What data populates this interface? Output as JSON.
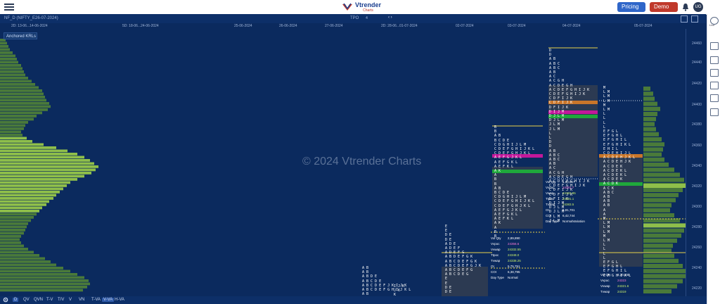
{
  "topbar": {
    "logo_name": "Vtrender",
    "logo_sub": "Charts",
    "pricing_label": "Pricing ₹",
    "demo_label": "Demo",
    "avatar_initials": "UG",
    "logo_mark_color": "#1a3f8f",
    "accent_red": "#c0392b"
  },
  "chartbar": {
    "symbol": "NF_D (NIFTY_E26-07-2024)",
    "timeframe": "TPO",
    "tpo_size": "4",
    "nav": "‹  ›"
  },
  "dates": [
    "2D: 13-06...14-06-2024",
    "5D: 18-06...24-06-2024",
    "25-06-2024",
    "26-06-2024",
    "27-06-2024",
    "2D: 28-06...01-07-2024",
    "02-07-2024",
    "03-07-2024",
    "04-07-2024",
    "05-07-2024"
  ],
  "anchored_label": "Anchored KRLs",
  "watermark": "© 2024 Vtrender Charts",
  "yaxis": [
    "24460",
    "24440",
    "24420",
    "24400",
    "24380",
    "24360",
    "24340",
    "24320",
    "24300",
    "24280",
    "24260",
    "24240",
    "24220"
  ],
  "sidebar": {
    "top_label": "Live"
  },
  "bottombar": {
    "items": [
      "D",
      "QV",
      "QVN",
      "T-V",
      "T/V",
      "V",
      "VN",
      "T-VA",
      "V-VA",
      "H-VA"
    ]
  },
  "stats_day4": {
    "rows": [
      {
        "label": "Vol Qty",
        "value": "1,90,917"
      },
      {
        "label": "Vvpoc",
        "value": "24381.7"
      },
      {
        "label": "Vwap",
        "value": "24383.85"
      },
      {
        "label": "Ttpoc",
        "value": "24391.1"
      },
      {
        "label": "Tvwap",
        "value": "24383.5"
      },
      {
        "label": "OI",
        "value": "5,81,701"
      },
      {
        "label": "COI",
        "value": "6,42,744"
      },
      {
        "label": "Day Type",
        "value": "NormalVariation"
      }
    ]
  },
  "stats_day3": {
    "rows": [
      {
        "label": "Vol Qty",
        "value": "2,89,890"
      },
      {
        "label": "Vvpoc",
        "value": "24356.6"
      },
      {
        "label": "Vvwap",
        "value": "24332.55"
      },
      {
        "label": "Ttpoc",
        "value": "24348.0"
      },
      {
        "label": "Tvwap",
        "value": "24338.25"
      },
      {
        "label": "OI",
        "value": "5,75,751"
      },
      {
        "label": "COI",
        "value": "6,38,795"
      },
      {
        "label": "Day Type",
        "value": "Normal"
      }
    ]
  },
  "stats_day5": {
    "rows": [
      {
        "label": "Vol Qty",
        "value": "2,30,140"
      },
      {
        "label": "Vvpoc",
        "value": "24323"
      },
      {
        "label": "Vvwap",
        "value": "24321.6"
      },
      {
        "label": "Tvwap",
        "value": "24319"
      }
    ]
  },
  "colors": {
    "bg": "#0b2a5e",
    "profile_green": "#4a7a3a",
    "profile_green_light": "#8fbf4a",
    "tpo_letter": "#ffffff",
    "tpo_yellow": "#e8d24a",
    "poc_band": "#1fa83b",
    "single_band": "#c2189a",
    "orange_band": "#c9762a"
  }
}
